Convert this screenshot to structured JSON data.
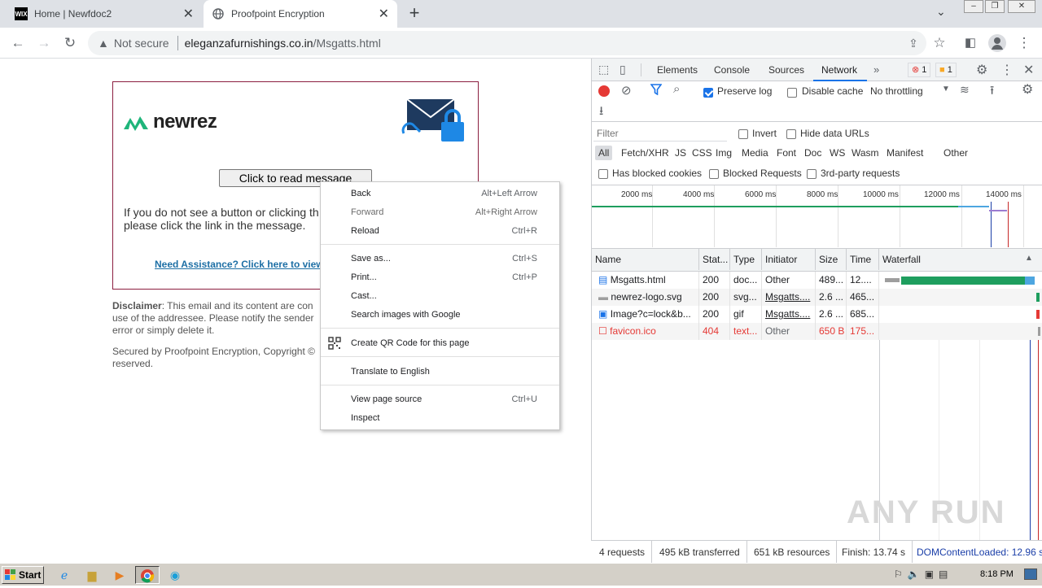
{
  "browser": {
    "tabs": [
      {
        "title": "Home | Newfdoc2",
        "favicon": "WIX"
      },
      {
        "title": "Proofpoint Encryption"
      }
    ],
    "url": {
      "security": "Not secure",
      "host": "eleganzafurnishings.co.in",
      "path": "/Msgatts.html"
    }
  },
  "page": {
    "logo_text": "newrez",
    "read_button": "Click to read message",
    "instructions": "If you do not see a button or clicking th please click the link in the message.",
    "assistance_link": "Need Assistance? Click here to view",
    "disclaimer_label": "Disclaimer",
    "disclaimer_text": ": This email and its content are con use of the addressee. Please notify the sender error or simply delete it.",
    "secured_text": "Secured by Proofpoint Encryption, Copyright © reserved."
  },
  "context_menu": {
    "items": [
      {
        "label": "Back",
        "shortcut": "Alt+Left Arrow"
      },
      {
        "label": "Forward",
        "shortcut": "Alt+Right Arrow"
      },
      {
        "label": "Reload",
        "shortcut": "Ctrl+R"
      },
      {
        "label": "Save as...",
        "shortcut": "Ctrl+S"
      },
      {
        "label": "Print...",
        "shortcut": "Ctrl+P"
      },
      {
        "label": "Cast..."
      },
      {
        "label": "Search images with Google"
      },
      {
        "label": "Create QR Code for this page"
      },
      {
        "label": "Translate to English"
      },
      {
        "label": "View page source",
        "shortcut": "Ctrl+U"
      },
      {
        "label": "Inspect"
      }
    ]
  },
  "devtools": {
    "tabs": [
      "Elements",
      "Console",
      "Sources",
      "Network"
    ],
    "active_tab": "Network",
    "error_count": "1",
    "warning_count": "1",
    "toolbar": {
      "preserve_log": "Preserve log",
      "disable_cache": "Disable cache",
      "throttling": "No throttling"
    },
    "filter_placeholder": "Filter",
    "invert": "Invert",
    "hide_data_urls": "Hide data URLs",
    "type_filters": [
      "All",
      "Fetch/XHR",
      "JS",
      "CSS",
      "Img",
      "Media",
      "Font",
      "Doc",
      "WS",
      "Wasm",
      "Manifest",
      "Other"
    ],
    "blocked_cookies": "Has blocked cookies",
    "blocked_requests": "Blocked Requests",
    "third_party": "3rd-party requests",
    "timeline_ticks": [
      "2000 ms",
      "4000 ms",
      "6000 ms",
      "8000 ms",
      "10000 ms",
      "12000 ms",
      "14000 ms"
    ],
    "columns": [
      "Name",
      "Stat...",
      "Type",
      "Initiator",
      "Size",
      "Time",
      "Waterfall"
    ],
    "requests": [
      {
        "name": "Msgatts.html",
        "status": "200",
        "type": "doc...",
        "initiator": "Other",
        "size": "489...",
        "time": "12...."
      },
      {
        "name": "newrez-logo.svg",
        "status": "200",
        "type": "svg...",
        "initiator": "Msgatts....",
        "size": "2.6 ...",
        "time": "465..."
      },
      {
        "name": "Image?c=lock&b...",
        "status": "200",
        "type": "gif",
        "initiator": "Msgatts....",
        "size": "2.6 ...",
        "time": "685..."
      },
      {
        "name": "favicon.ico",
        "status": "404",
        "type": "text...",
        "initiator": "Other",
        "size": "650 B",
        "time": "175..."
      }
    ],
    "status": {
      "requests": "4 requests",
      "transferred": "495 kB transferred",
      "resources": "651 kB resources",
      "finish": "Finish: 13.74 s",
      "dcl": "DOMContentLoaded: 12.96 s"
    }
  },
  "taskbar": {
    "start": "Start",
    "clock": "8:18 PM"
  },
  "watermark": "ANY RUN",
  "colors": {
    "accent": "#1a73e8",
    "error": "#e53935",
    "frame": "#8b1e3f",
    "logo_green": "#1fb57a"
  }
}
